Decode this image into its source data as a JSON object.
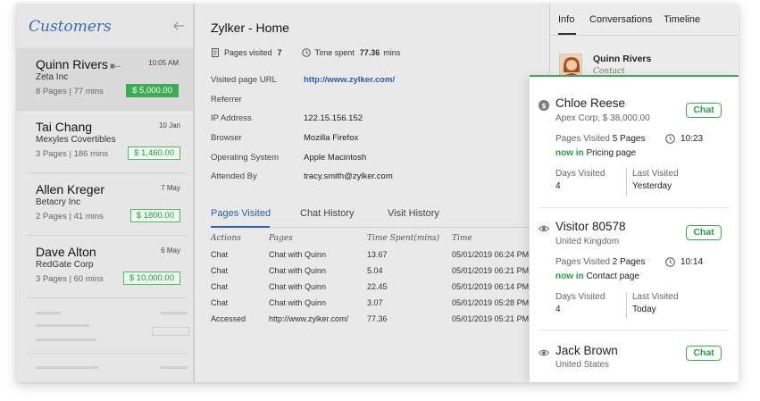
{
  "sidebar": {
    "title": "Customers",
    "customers": [
      {
        "name": "Quinn Rivers",
        "company": "Zeta Inc",
        "stats": "8 Pages | 77 mins",
        "date": "10:05 AM",
        "amount": "$ 5,000.00"
      },
      {
        "name": "Tai Chang",
        "company": "Mexyles Covertibles",
        "stats": "3 Pages | 186 mins",
        "date": "10 Jan",
        "amount": "$ 1,460.00"
      },
      {
        "name": "Allen Kreger",
        "company": "Betacry Inc",
        "stats": "2 Pages | 41 mins",
        "date": "7 May",
        "amount": "$ 1800.00"
      },
      {
        "name": "Dave Alton",
        "company": "RedGate Corp",
        "stats": "3 Pages | 60 mins",
        "date": "6 May",
        "amount": "$ 10,000.00"
      }
    ]
  },
  "main": {
    "title": "Zylker - Home",
    "pages_visited_label": "Pages visited",
    "pages_visited_value": "7",
    "time_spent_label": "Time spent",
    "time_spent_value": "77.36",
    "time_spent_unit": "mins",
    "details": [
      {
        "label": "Visited page URL",
        "value": "http://www.zylker.com/"
      },
      {
        "label": "Referrer",
        "value": ""
      },
      {
        "label": "IP Address",
        "value": "122.15.156.152"
      },
      {
        "label": "Browser",
        "value": "Mozilla Firefox"
      },
      {
        "label": "Operating System",
        "value": "Apple Macintosh"
      },
      {
        "label": "Attended By",
        "value": "tracy.smith@zylker.com"
      }
    ],
    "tabs": [
      "Pages Visited",
      "Chat History",
      "Visit History"
    ],
    "table": {
      "headers": [
        "Actions",
        "Pages",
        "Time Spent(mins)",
        "Time"
      ],
      "rows": [
        [
          "Chat",
          "Chat with Quinn",
          "13.67",
          "05/01/2019 06:24 PM"
        ],
        [
          "Chat",
          "Chat with Quinn",
          "5.04",
          "05/01/2019 06:21 PM"
        ],
        [
          "Chat",
          "Chat with Quinn",
          "22.45",
          "05/01/2019 06:14 PM"
        ],
        [
          "Chat",
          "Chat with Quinn",
          "3.07",
          "05/01/2019 05:28 PM"
        ],
        [
          "Accessed",
          "http://www.zylker.com/",
          "77.36",
          "05/01/2019 05:21 PM"
        ]
      ]
    }
  },
  "right_panel": {
    "tabs": [
      "Info",
      "Conversations",
      "Timeline"
    ],
    "contact_name": "Quinn Rivers",
    "contact_role": "Contact"
  },
  "visitors": [
    {
      "icon": "dollar-icon",
      "name": "Chloe Reese",
      "sub": "Apex Corp, $ 38,000,00",
      "chat_label": "Chat",
      "pages_label": "Pages Visited",
      "pages_value": "5 Pages",
      "time": "10:23",
      "now_in_label": "now in",
      "now_in_page": "Pricing page",
      "days_label": "Days Visited",
      "days_value": "4",
      "last_label": "Last Visited",
      "last_value": "Yesterday"
    },
    {
      "icon": "eye-icon",
      "name": "Visitor 80578",
      "sub": "United Kingdom",
      "chat_label": "Chat",
      "pages_label": "Pages Visited",
      "pages_value": "2 Pages",
      "time": "10:14",
      "now_in_label": "now in",
      "now_in_page": "Contact page",
      "days_label": "Days Visited",
      "days_value": "4",
      "last_label": "Last Visited",
      "last_value": "Today"
    },
    {
      "icon": "eye-icon",
      "name": "Jack Brown",
      "sub": "United States",
      "chat_label": "Chat"
    }
  ],
  "colors": {
    "accent_blue": "#2a5db0",
    "accent_green": "#2e9b47",
    "sidebar_title": "#3a6bb0"
  }
}
